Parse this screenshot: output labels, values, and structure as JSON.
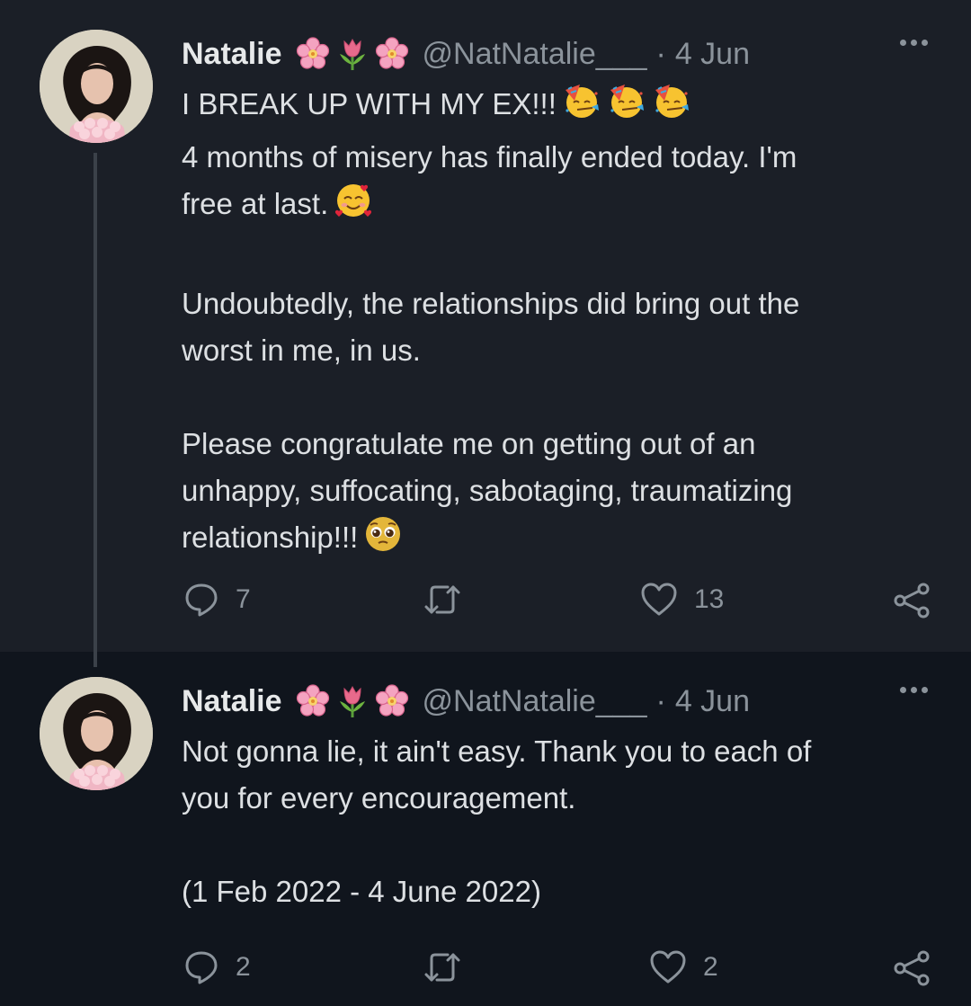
{
  "tweets": [
    {
      "name": "Natalie",
      "handle": "@NatNatalie___",
      "separator": "·",
      "date": "4 Jun",
      "lines": [
        "I BREAK UP WITH MY EX!!!",
        "4 months of misery has finally ended today. I'm",
        "free at last.",
        "Undoubtedly, the relationships did bring out the",
        "worst in me, in us.",
        "Please congratulate me on getting out of an",
        "unhappy, suffocating, sabotaging, traumatizing",
        "relationship!!!"
      ],
      "replies": "7",
      "likes": "13"
    },
    {
      "name": "Natalie",
      "handle": "@NatNatalie___",
      "separator": "·",
      "date": "4 Jun",
      "lines": [
        "Not gonna lie, it ain't easy. Thank you to each of",
        "you for every encouragement.",
        "(1 Feb 2022 - 4 June 2022)"
      ],
      "replies": "2",
      "likes": "2"
    }
  ],
  "icons": {
    "name_emojis": [
      "cherry-blossom",
      "tulip",
      "cherry-blossom"
    ],
    "line1_emojis": [
      "partying-face",
      "partying-face",
      "partying-face"
    ],
    "line3_emoji": "smiling-face-with-hearts",
    "line8_emoji": "pleading-face",
    "actions": [
      "reply-icon",
      "retweet-icon",
      "like-icon",
      "share-icon"
    ]
  },
  "colors": {
    "background": "#10151d",
    "highlighted_tweet_bg": "#1b1f27",
    "text": "#dde0e3",
    "muted": "#8b939b",
    "thread_line": "#3b4149"
  }
}
